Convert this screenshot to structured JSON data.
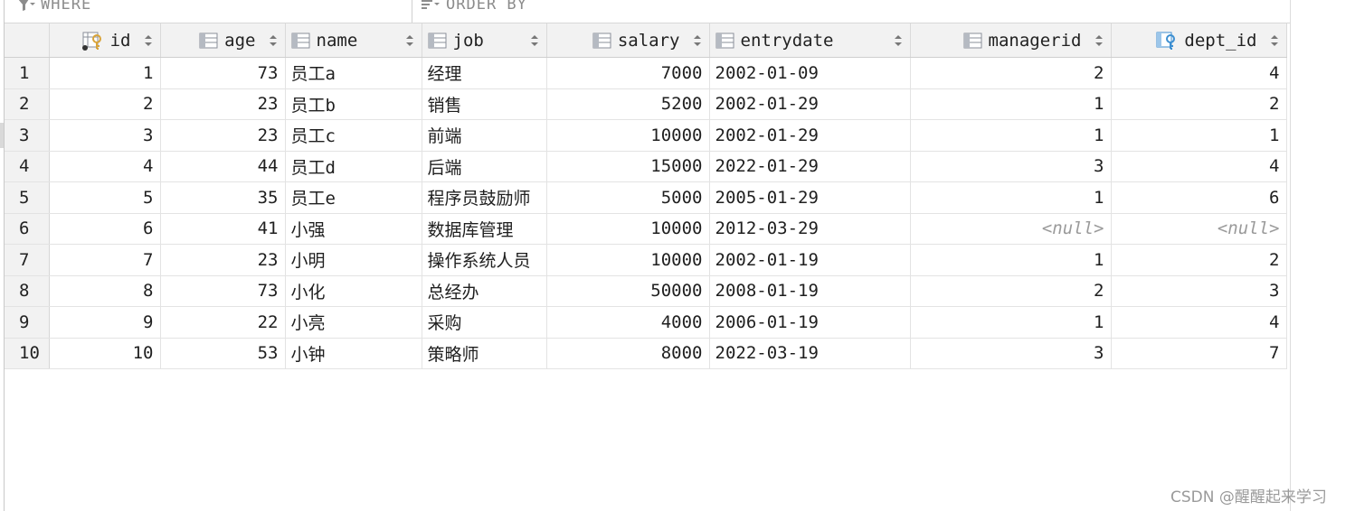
{
  "filter": {
    "where_label": "WHERE",
    "order_label": "ORDER BY"
  },
  "columns": [
    {
      "key": "id",
      "label": "id",
      "icon": "primary-key-icon"
    },
    {
      "key": "age",
      "label": "age",
      "icon": "column-icon"
    },
    {
      "key": "name",
      "label": "name",
      "icon": "column-icon"
    },
    {
      "key": "job",
      "label": "job",
      "icon": "column-icon"
    },
    {
      "key": "salary",
      "label": "salary",
      "icon": "column-icon"
    },
    {
      "key": "entrydate",
      "label": "entrydate",
      "icon": "column-icon"
    },
    {
      "key": "managerid",
      "label": "managerid",
      "icon": "column-icon"
    },
    {
      "key": "dept_id",
      "label": "dept_id",
      "icon": "foreign-key-icon"
    }
  ],
  "rows": [
    {
      "n": "1",
      "id": "1",
      "age": "73",
      "name": "员工a",
      "job": "经理",
      "salary": "7000",
      "entrydate": "2002-01-09",
      "managerid": "2",
      "dept_id": "4"
    },
    {
      "n": "2",
      "id": "2",
      "age": "23",
      "name": "员工b",
      "job": "销售",
      "salary": "5200",
      "entrydate": "2002-01-29",
      "managerid": "1",
      "dept_id": "2"
    },
    {
      "n": "3",
      "id": "3",
      "age": "23",
      "name": "员工c",
      "job": "前端",
      "salary": "10000",
      "entrydate": "2002-01-29",
      "managerid": "1",
      "dept_id": "1"
    },
    {
      "n": "4",
      "id": "4",
      "age": "44",
      "name": "员工d",
      "job": "后端",
      "salary": "15000",
      "entrydate": "2022-01-29",
      "managerid": "3",
      "dept_id": "4"
    },
    {
      "n": "5",
      "id": "5",
      "age": "35",
      "name": "员工e",
      "job": "程序员鼓励师",
      "salary": "5000",
      "entrydate": "2005-01-29",
      "managerid": "1",
      "dept_id": "6"
    },
    {
      "n": "6",
      "id": "6",
      "age": "41",
      "name": "小强",
      "job": "数据库管理",
      "salary": "10000",
      "entrydate": "2012-03-29",
      "managerid": "<null>",
      "dept_id": "<null>"
    },
    {
      "n": "7",
      "id": "7",
      "age": "23",
      "name": "小明",
      "job": "操作系统人员",
      "salary": "10000",
      "entrydate": "2002-01-19",
      "managerid": "1",
      "dept_id": "2"
    },
    {
      "n": "8",
      "id": "8",
      "age": "73",
      "name": "小化",
      "job": "总经办",
      "salary": "50000",
      "entrydate": "2008-01-19",
      "managerid": "2",
      "dept_id": "3"
    },
    {
      "n": "9",
      "id": "9",
      "age": "22",
      "name": "小亮",
      "job": "采购",
      "salary": "4000",
      "entrydate": "2006-01-19",
      "managerid": "1",
      "dept_id": "4"
    },
    {
      "n": "10",
      "id": "10",
      "age": "53",
      "name": "小钟",
      "job": "策略师",
      "salary": "8000",
      "entrydate": "2022-03-19",
      "managerid": "3",
      "dept_id": "7"
    }
  ],
  "watermark": "CSDN @醒醒起来学习",
  "colors": {
    "key_gold": "#d9a43a",
    "fk_blue": "#3d8fd1",
    "icon_gray": "#8a8f98",
    "null_gray": "#9a9a9a"
  }
}
